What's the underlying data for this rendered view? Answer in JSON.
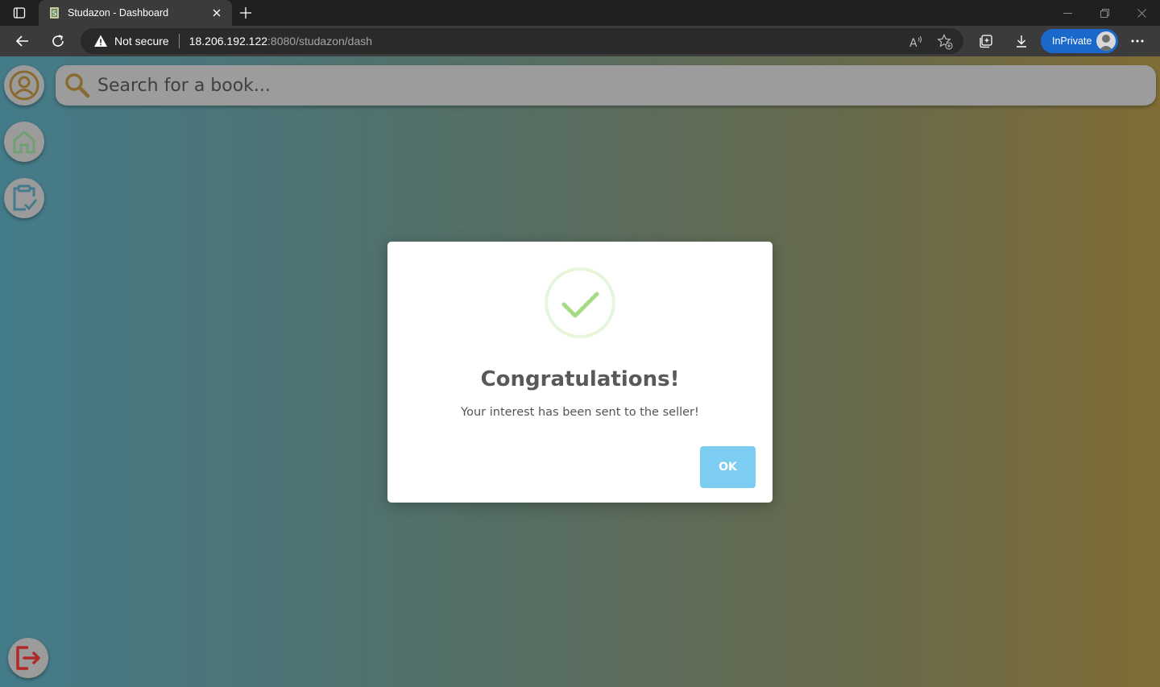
{
  "browser": {
    "tab_title": "Studazon - Dashboard",
    "security_label": "Not secure",
    "url_host": "18.206.192.122",
    "url_rest": ":8080/studazon/dash",
    "inprivate_label": "InPrivate"
  },
  "app": {
    "search_placeholder": "Search for a book...",
    "sidebar": [
      "profile-icon",
      "home-icon",
      "clipboard-check-icon"
    ],
    "logout_icon": "logout-icon"
  },
  "modal": {
    "title": "Congratulations!",
    "message": "Your interest has been sent to the seller!",
    "ok_label": "OK",
    "icon": "success-check-icon"
  },
  "colors": {
    "accent_gold": "#8a6a2e",
    "home_green": "#6f9f73",
    "clipboard_teal": "#447a8c",
    "logout_red": "#b2292a",
    "ok_button": "#7dcdf3",
    "success_green": "#a5dc86"
  }
}
